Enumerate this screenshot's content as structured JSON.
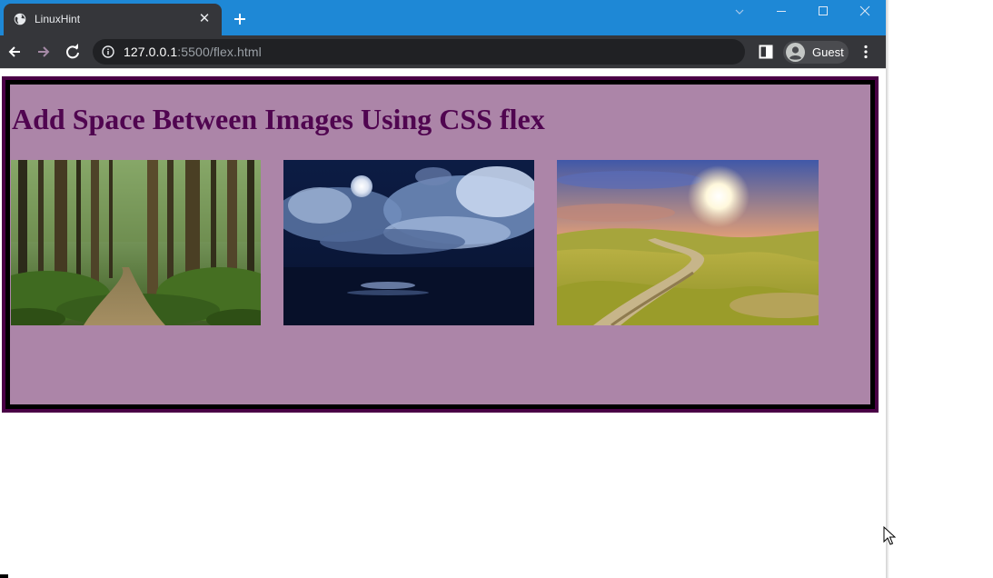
{
  "browser": {
    "tab": {
      "title": "LinuxHint",
      "favicon": "globe-icon"
    },
    "address": {
      "host": "127.0.0.1",
      "rest": ":5500/flex.html"
    },
    "profile": {
      "label": "Guest"
    },
    "colors": {
      "titlebar": "#1e88d6",
      "toolbar": "#35363a",
      "omnibox": "#202124"
    }
  },
  "page": {
    "heading": "Add Space Between Images Using CSS flex",
    "colors": {
      "panel": "#ac85a8",
      "heading": "#500550",
      "outer_border": "#4a0046",
      "inner_border": "#000000"
    },
    "images": [
      {
        "subject": "forest-path"
      },
      {
        "subject": "moonlit-clouds-over-sea"
      },
      {
        "subject": "sunny-meadow-road"
      }
    ]
  }
}
